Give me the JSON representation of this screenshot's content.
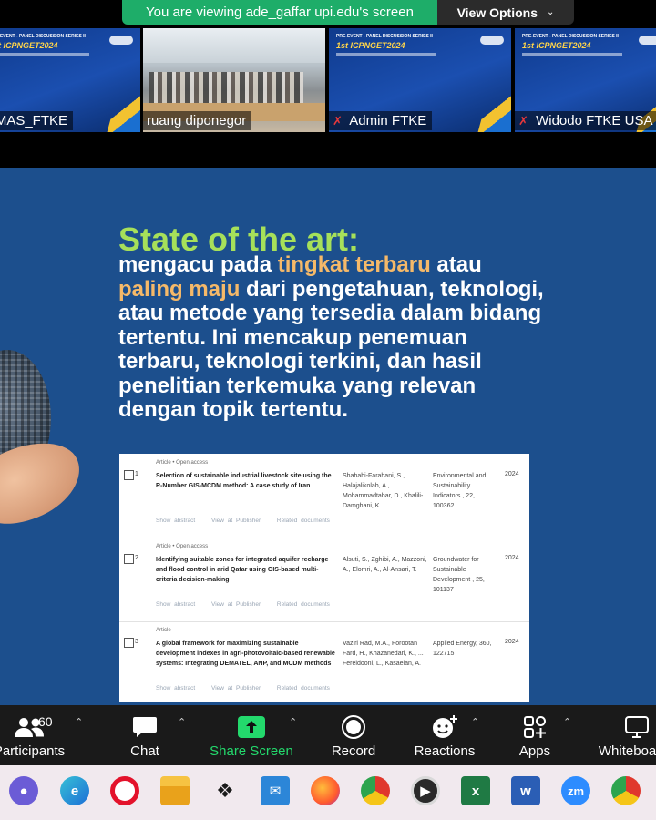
{
  "banner": {
    "viewing_text": "You are viewing ade_gaffar upi.edu's screen",
    "view_options": "View Options"
  },
  "participants": [
    {
      "name": "UMAS_FTKE",
      "muted": false
    },
    {
      "name": "ruang diponegor",
      "muted": false
    },
    {
      "name": "Admin FTKE",
      "muted": true
    },
    {
      "name": "Widodo FTKE USA",
      "muted": true
    }
  ],
  "tile_text": {
    "series": "PRE-EVENT - PANEL DISCUSSION SERIES II",
    "event": "1st ICPNGET2024"
  },
  "slide": {
    "title": "State of the art:",
    "body": {
      "p1": "mengacu pada ",
      "h1": "tingkat terbaru",
      "p2": " atau ",
      "h2": "paling maju",
      "p3": " dari pengetahuan, teknologi, atau metode yang tersedia dalam bidang tertentu. Ini mencakup penemuan terbaru, teknologi terkini, dan hasil penelitian terkemuka yang relevan dengan topik tertentu."
    }
  },
  "articles": [
    {
      "num": "1",
      "kind": "Article • Open access",
      "title": "Selection of sustainable industrial livestock site using the R-Number GIS-MCDM method: A case study of Iran",
      "authors": "Shahabi-Farahani, S., Halajalikolab, A., Mohammadtabar, D., Khalili-Damghani, K.",
      "source": "Environmental and Sustainability Indicators , 22, 100362",
      "year": "2024"
    },
    {
      "num": "2",
      "kind": "Article • Open access",
      "title": "Identifying suitable zones for integrated aquifer recharge and flood control in arid Qatar using GIS-based multi-criteria decision-making",
      "authors": "Alsuti, S., Zghibi, A., Mazzoni, A., Elomri, A., Al-Ansari, T.",
      "source": "Groundwater for Sustainable Development , 25, 101137",
      "year": "2024"
    },
    {
      "num": "3",
      "kind": "Article",
      "title": "A global framework for maximizing sustainable development indexes in agri-photovoltaic-based renewable systems: Integrating DEMATEL, ANP, and MCDM methods",
      "authors": "Vaziri Rad, M.A., Forootan Fard, H., Khazanedari, K., ... Fereidooni, L., Kasaeian, A.",
      "source": "Applied Energy, 360, 122715",
      "year": "2024"
    }
  ],
  "article_links": {
    "show_abstract": "Show abstract",
    "view_at_publisher": "View at Publisher",
    "related": "Related documents"
  },
  "toolbar": {
    "participants_label": "Participants",
    "participants_count": "60",
    "chat": "Chat",
    "share_screen": "Share Screen",
    "record": "Record",
    "reactions": "Reactions",
    "apps": "Apps",
    "whiteboards": "Whiteboards"
  },
  "colors": {
    "banner_green": "#1ead69",
    "slide_bg": "#1c4f8d",
    "title_green": "#a6e05a",
    "highlight_orange": "#f5b969",
    "share_green": "#23d96c"
  },
  "taskbar_apps": [
    "discord-icon",
    "edge-icon",
    "opera-icon",
    "files-icon",
    "dropbox-icon",
    "mail-icon",
    "firefox-icon",
    "chrome-profile-icon",
    "media-player-icon",
    "excel-icon",
    "word-icon",
    "zoom-icon",
    "chrome-icon"
  ]
}
